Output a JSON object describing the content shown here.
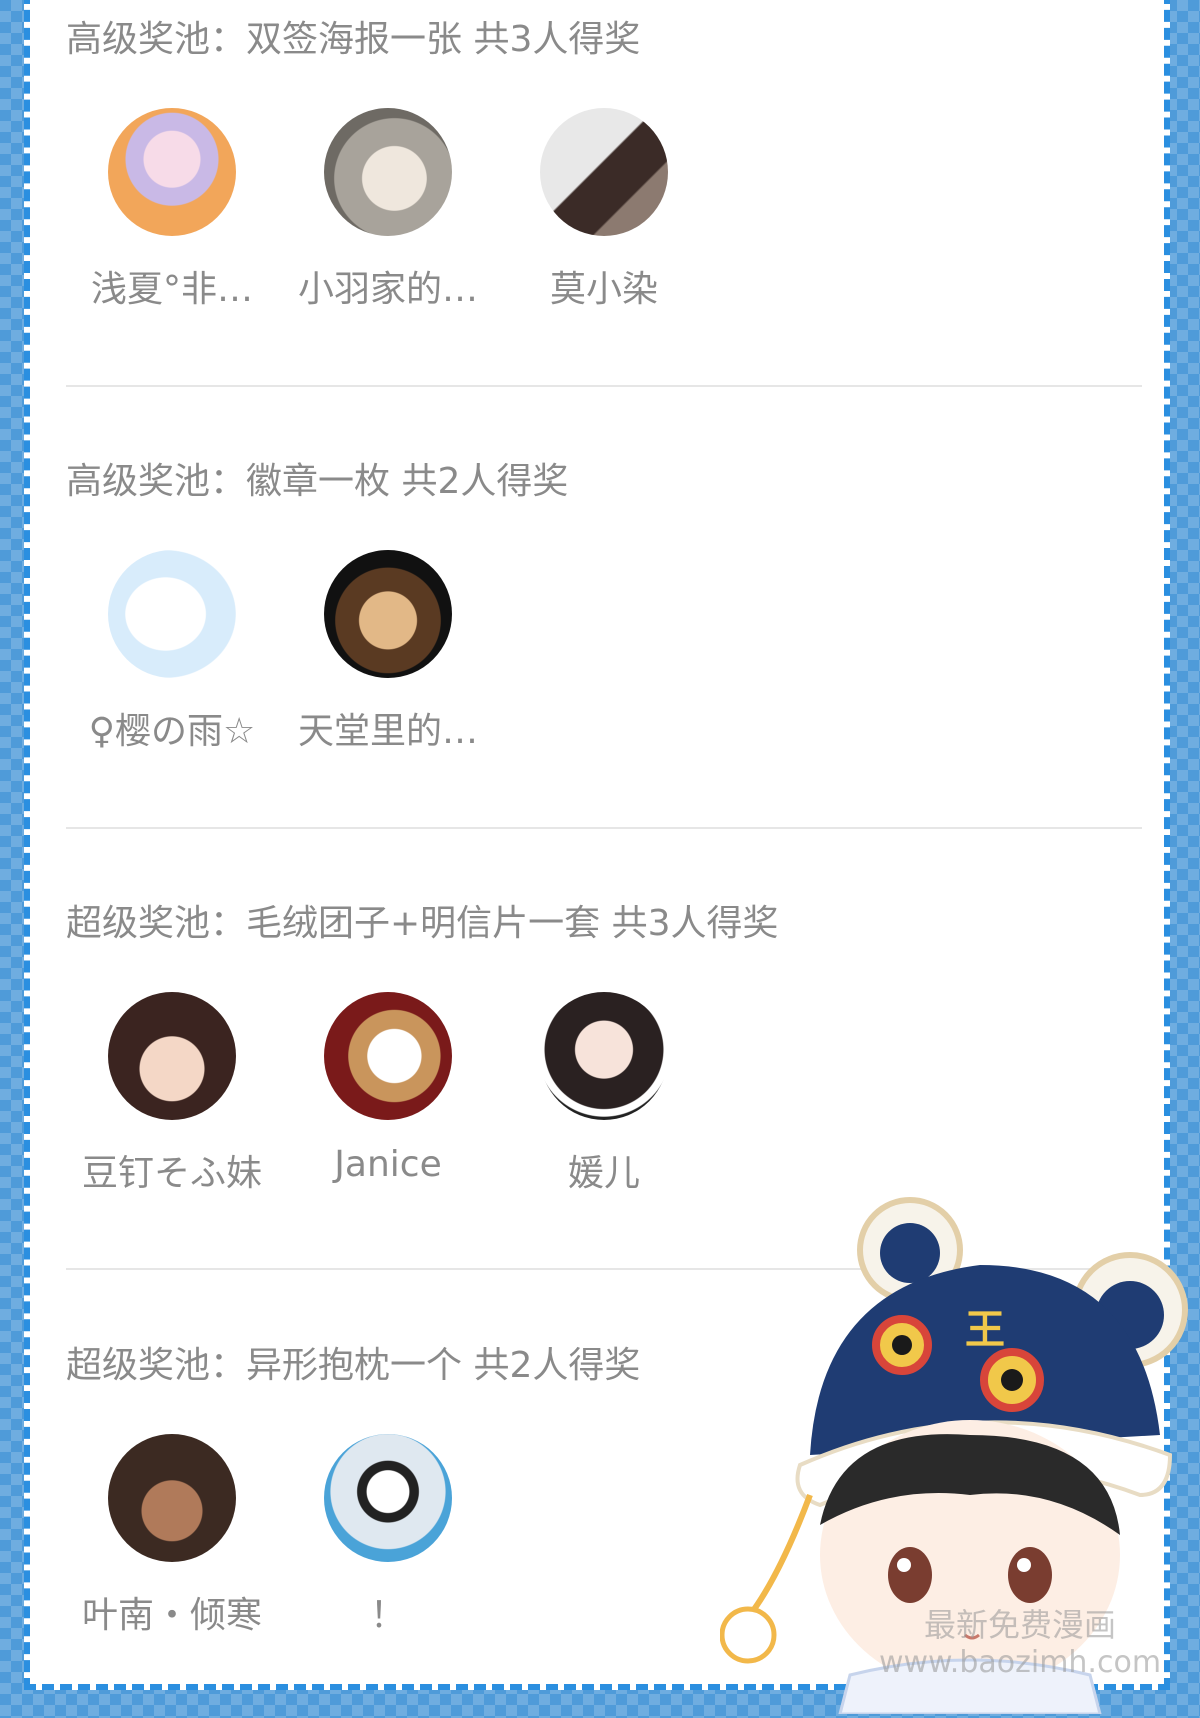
{
  "prize_sections": [
    {
      "title": "高级奖池：双签海报一张 共3人得奖",
      "winners": [
        {
          "name": "浅夏°非…"
        },
        {
          "name": "小羽家的…"
        },
        {
          "name": "莫小染"
        }
      ]
    },
    {
      "title": "高级奖池：徽章一枚 共2人得奖",
      "winners": [
        {
          "name": "♀樱の雨☆"
        },
        {
          "name": "天堂里的…"
        }
      ]
    },
    {
      "title": "超级奖池：毛绒团子+明信片一套 共3人得奖",
      "winners": [
        {
          "name": "豆钉そふ妹"
        },
        {
          "name": "Janice"
        },
        {
          "name": "媛儿"
        }
      ]
    },
    {
      "title": "超级奖池：异形抱枕一个 共2人得奖",
      "winners": [
        {
          "name": "叶南・倾寒"
        },
        {
          "name": "！"
        }
      ]
    }
  ],
  "mascot": {
    "hat_text": "王"
  },
  "watermark": {
    "line1": "最新免费漫画",
    "line2": "www.baozimh.com"
  },
  "colors": {
    "border": "#2b8fe0",
    "background": "#4f9bd9",
    "text": "#8a8a8a"
  }
}
